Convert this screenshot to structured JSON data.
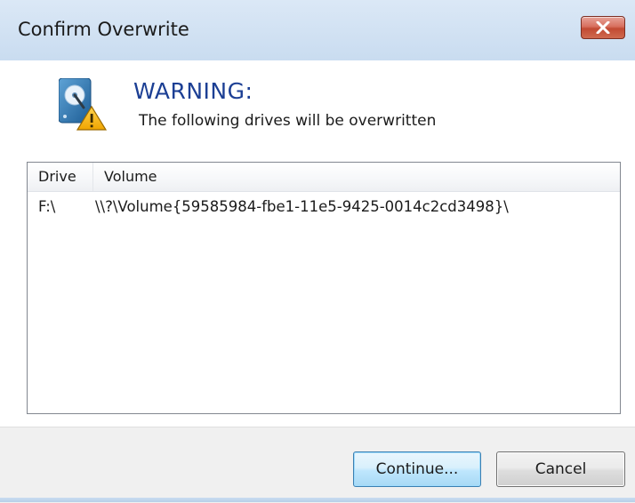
{
  "window": {
    "title": "Confirm Overwrite"
  },
  "warning": {
    "title": "WARNING:",
    "message": "The following drives will be overwritten"
  },
  "list": {
    "columns": [
      "Drive",
      "Volume"
    ],
    "rows": [
      {
        "drive": "F:\\",
        "volume": "\\\\?\\Volume{59585984-fbe1-11e5-9425-0014c2cd3498}\\"
      }
    ]
  },
  "buttons": {
    "continue_label": "Continue...",
    "cancel_label": "Cancel"
  },
  "icons": {
    "close": "close-icon",
    "drive": "hard-drive-warning-icon"
  },
  "colors": {
    "warning_title": "#1c3f94",
    "titlebar": "#d2e2f3",
    "close_button": "#c24a33",
    "default_button_border": "#3c7fb1"
  }
}
